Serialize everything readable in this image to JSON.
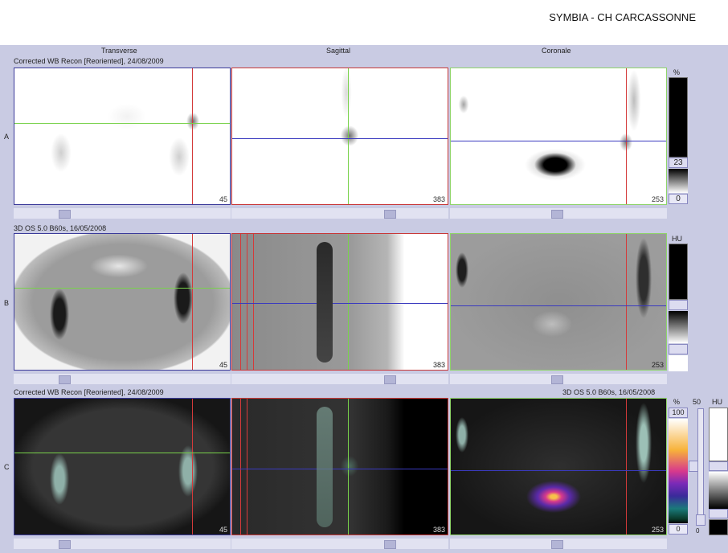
{
  "header": {
    "site": "SYMBIA - CH CARCASSONNE"
  },
  "columns": {
    "transverse": "Transverse",
    "sagittal": "Sagittal",
    "coronal": "Coronale"
  },
  "rows": {
    "a": {
      "label": "A",
      "title": "Corrected WB Recon [Reoriented], 24/08/2009",
      "nums": [
        "45",
        "383",
        "253"
      ],
      "scale_unit": "%",
      "scale_top": "23",
      "scale_bottom": "0"
    },
    "b": {
      "label": "B",
      "title": "3D  OS  5.0  B60s, 16/05/2008",
      "nums": [
        "45",
        "383",
        "253"
      ],
      "scale_unit": "HU"
    },
    "c": {
      "label": "C",
      "title_left": "Corrected WB Recon [Reoriented], 24/08/2009",
      "title_right": "3D  OS  5.0  B60s, 16/05/2008",
      "nums": [
        "45",
        "383",
        "253"
      ],
      "scale_unit": "%",
      "scale_top": "100",
      "scale_bottom": "0",
      "scale2_top": "50",
      "scale2_bottom": "0",
      "scale3_unit": "HU"
    }
  },
  "colors": {
    "transverse_border": "#3a3a9a",
    "sagittal_border": "#c83838",
    "coronal_border": "#8fd46a",
    "crosshair_red": "#d43a3a",
    "crosshair_green": "#78d24a",
    "crosshair_blue": "#3a3abf"
  }
}
